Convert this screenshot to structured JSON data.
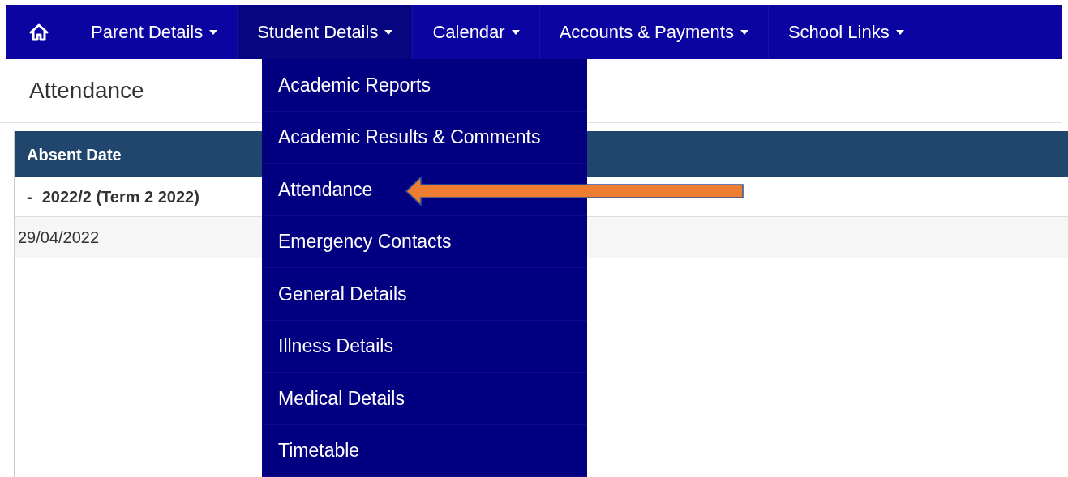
{
  "nav": {
    "items": [
      {
        "kind": "home",
        "selected": false
      },
      {
        "kind": "menu",
        "label": "Parent Details",
        "selected": false
      },
      {
        "kind": "menu",
        "label": "Student Details",
        "selected": true
      },
      {
        "kind": "menu",
        "label": "Calendar",
        "selected": false
      },
      {
        "kind": "menu",
        "label": "Accounts & Payments",
        "selected": false
      },
      {
        "kind": "menu",
        "label": "School Links",
        "selected": false
      }
    ]
  },
  "dropdown": {
    "items": [
      {
        "label": "Academic Reports",
        "pointed": false
      },
      {
        "label": "Academic Results & Comments",
        "pointed": false
      },
      {
        "label": "Attendance",
        "pointed": true
      },
      {
        "label": "Emergency Contacts",
        "pointed": false
      },
      {
        "label": "General Details",
        "pointed": false
      },
      {
        "label": "Illness Details",
        "pointed": false
      },
      {
        "label": "Medical Details",
        "pointed": false
      },
      {
        "label": "Timetable",
        "pointed": false
      }
    ]
  },
  "page": {
    "title": "Attendance"
  },
  "table": {
    "columns": [
      "Absent Date"
    ],
    "groups": [
      {
        "toggle": "-",
        "label": "2022/2 (Term 2 2022)",
        "rows": [
          [
            "29/04/2022"
          ]
        ]
      }
    ]
  }
}
